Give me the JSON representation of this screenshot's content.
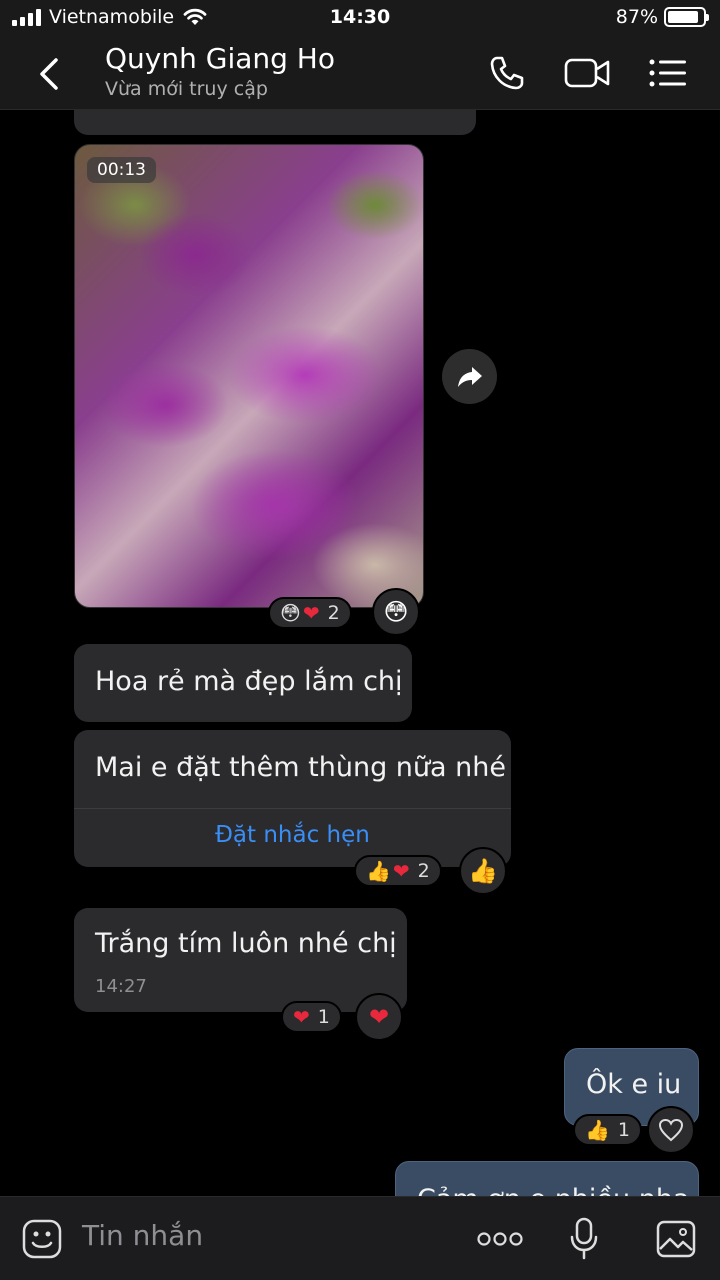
{
  "status_bar": {
    "carrier": "Vietnamobile",
    "time": "14:30",
    "battery_percent": "87%",
    "battery_level": 0.87
  },
  "header": {
    "contact_name": "Quynh Giang Ho",
    "contact_status": "Vừa mới truy cập"
  },
  "messages": {
    "video": {
      "duration": "00:13",
      "reaction_count": "2"
    },
    "msg1": {
      "text": "Hoa rẻ mà đẹp lắm chị"
    },
    "msg2": {
      "text": "Mai e đặt thêm thùng nữa nhé",
      "reminder_link": "Đặt nhắc hẹn",
      "reaction_count": "2"
    },
    "msg3": {
      "text": "Trắng tím luôn nhé chị",
      "time": "14:27",
      "reaction_count": "1"
    },
    "out1": {
      "text": "Ôk e iu",
      "reaction_count": "1"
    },
    "out2": {
      "text": "Cảm ơn e nhiều nha"
    }
  },
  "input_bar": {
    "placeholder": "Tin nhắn"
  },
  "colors": {
    "accent": "#3a8ef6",
    "bubble_in": "#2b2b2d",
    "bubble_out": "#3a4c63",
    "background": "#000000"
  }
}
